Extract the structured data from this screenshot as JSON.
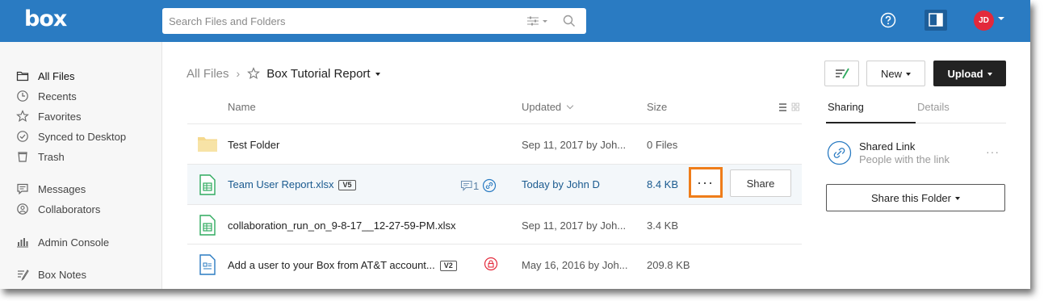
{
  "header": {
    "logo": "box",
    "search_placeholder": "Search Files and Folders",
    "avatar_initials": "JD"
  },
  "sidebar": {
    "items": [
      {
        "label": "All Files",
        "icon": "folder-icon"
      },
      {
        "label": "Recents",
        "icon": "clock-icon"
      },
      {
        "label": "Favorites",
        "icon": "star-icon"
      },
      {
        "label": "Synced to Desktop",
        "icon": "check-circle-icon"
      },
      {
        "label": "Trash",
        "icon": "trash-icon"
      },
      {
        "label": "Messages",
        "icon": "chat-icon"
      },
      {
        "label": "Collaborators",
        "icon": "user-icon"
      },
      {
        "label": "Admin Console",
        "icon": "bar-chart-icon"
      },
      {
        "label": "Box Notes",
        "icon": "notes-icon"
      }
    ]
  },
  "breadcrumb": {
    "root": "All Files",
    "separator": "›",
    "current": "Box Tutorial Report"
  },
  "columns": {
    "name": "Name",
    "updated": "Updated",
    "size": "Size"
  },
  "files": [
    {
      "name": "Test Folder",
      "type": "folder",
      "updated": "Sep 11, 2017 by Joh...",
      "size": "0 Files"
    },
    {
      "name": "Team User Report.xlsx",
      "type": "spreadsheet",
      "version": "V5",
      "comments": "1",
      "updated": "Today by John D",
      "size": "8.4 KB",
      "selected": true
    },
    {
      "name": "collaboration_run_on_9-8-17__12-27-59-PM.xlsx",
      "type": "spreadsheet",
      "updated": "Sep 11, 2017 by Joh...",
      "size": "3.4 KB"
    },
    {
      "name": "Add a user to your Box from AT&T account...",
      "type": "document",
      "version": "V2",
      "updated": "May 16, 2016 by Joh...",
      "size": "209.8 KB"
    }
  ],
  "row_actions": {
    "more": "...",
    "share": "Share"
  },
  "actions": {
    "new": "New",
    "upload": "Upload"
  },
  "sidepanel": {
    "tabs": [
      "Sharing",
      "Details"
    ],
    "shared_link_title": "Shared Link",
    "shared_link_sub": "People with the link",
    "more": "···",
    "share_folder": "Share this Folder"
  },
  "colors": {
    "header_bg": "#2a7bc2",
    "highlight": "#ef7d1a",
    "avatar": "#e3293b"
  }
}
